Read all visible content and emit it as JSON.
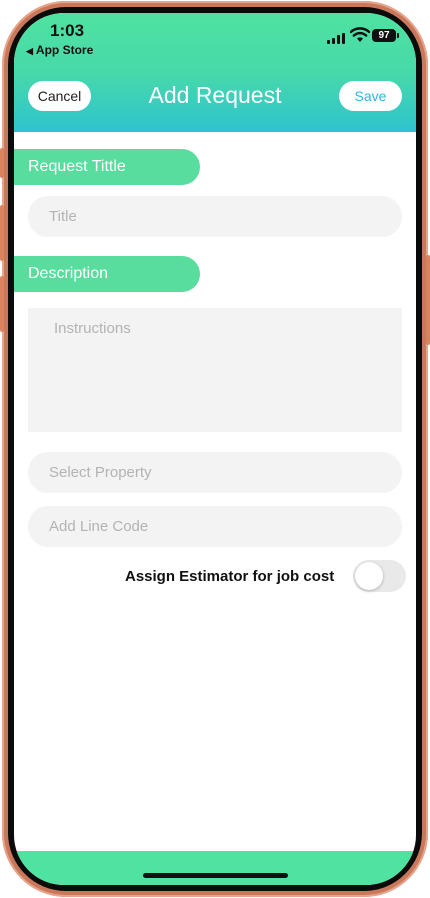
{
  "status_bar": {
    "time": "1:03",
    "back_label": "App Store",
    "battery": "97"
  },
  "nav": {
    "cancel_label": "Cancel",
    "title": "Add Request",
    "save_label": "Save"
  },
  "form": {
    "request_title_label": "Request Tittle",
    "title_placeholder": "Title",
    "description_label": "Description",
    "instructions_placeholder": "Instructions",
    "property_placeholder": "Select Property",
    "line_code_placeholder": "Add Line Code",
    "assign_estimator_label": "Assign Estimator for job cost",
    "assign_estimator_on": false
  },
  "colors": {
    "accent_green": "#4fe2a1",
    "accent_blue": "#2fc3d0",
    "frame": "#c9785a"
  }
}
